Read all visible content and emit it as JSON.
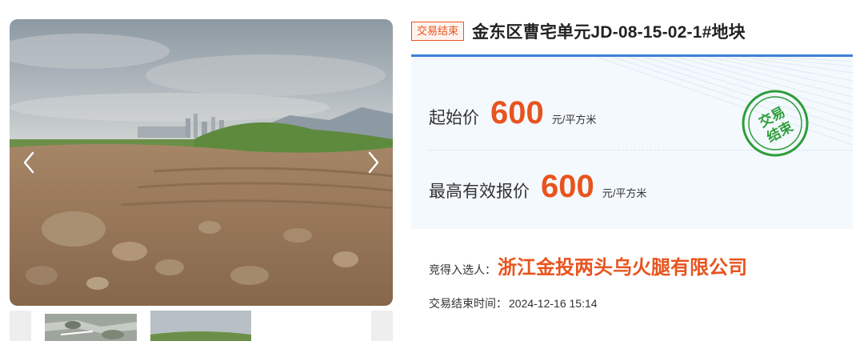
{
  "gallery": {
    "prev_icon": "chevron-left-icon",
    "next_icon": "chevron-right-icon",
    "thumbs_count": 2
  },
  "lot": {
    "status_tag": "交易结束",
    "title": "金东区曹宅单元JD-08-15-02-1#地块"
  },
  "prices": {
    "start_label": "起始价",
    "start_value": "600",
    "start_unit": "元/平方米",
    "high_label": "最高有效报价",
    "high_value": "600",
    "high_unit": "元/平方米"
  },
  "stamp": {
    "line1": "交易",
    "line2": "结束"
  },
  "result": {
    "winner_label": "竞得入选人：",
    "winner_name": "浙江金投两头乌火腿有限公司",
    "end_label": "交易结束时间：",
    "end_time": "2024-12-16 15:14"
  },
  "colors": {
    "accent_orange": "#e8541e",
    "accent_blue": "#3a7fd5",
    "stamp_green": "#2e9e3a",
    "panel_bg": "#f4f9fe"
  }
}
